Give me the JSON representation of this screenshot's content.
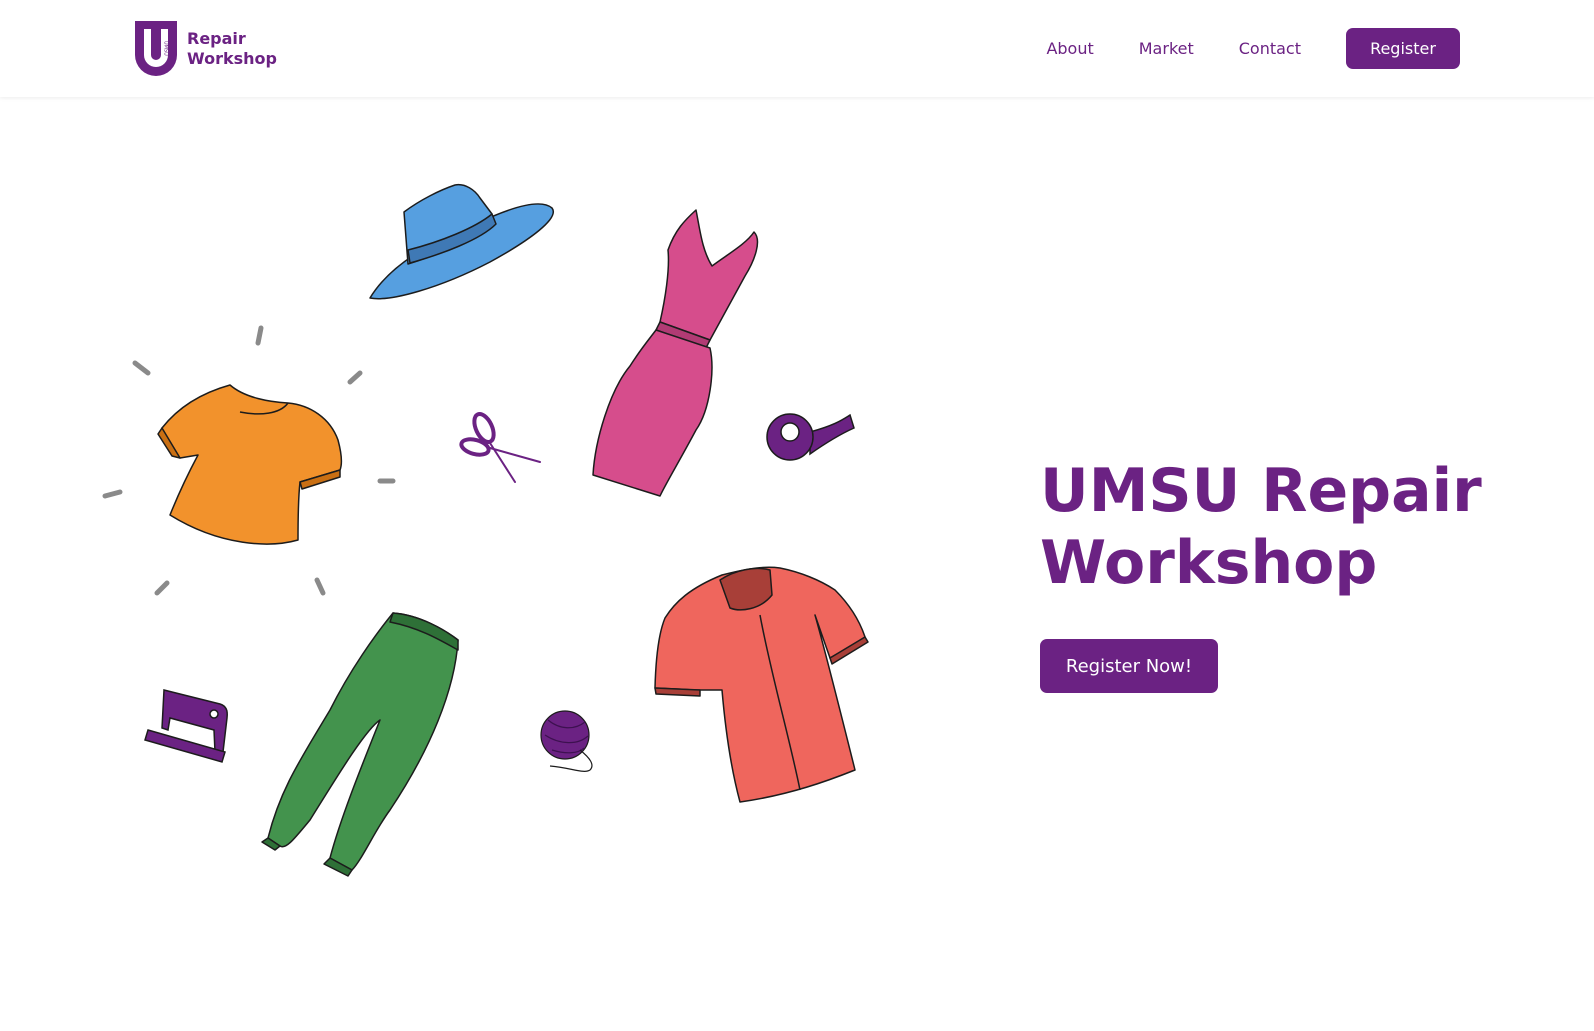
{
  "brand": {
    "logo_letter": "U",
    "logo_small": "UMSU",
    "line1": "Repair",
    "line2": "Workshop"
  },
  "nav": {
    "items": [
      {
        "label": "About"
      },
      {
        "label": "Market"
      },
      {
        "label": "Contact"
      }
    ],
    "register_label": "Register"
  },
  "hero": {
    "title_line1": "UMSU Repair",
    "title_line2": "Workshop",
    "cta_label": "Register Now!"
  },
  "colors": {
    "brand_purple": "#6b2283",
    "hat_blue": "#569fe0",
    "dress_pink": "#d64d8c",
    "tshirt_orange": "#f2922c",
    "pants_green": "#43934d",
    "shirt_coral": "#ef665d",
    "sparkle_gray": "#8a8a8a"
  },
  "illustration_icons": [
    "sun-hat-icon",
    "dress-icon",
    "tshirt-icon",
    "scissors-icon",
    "measuring-tape-icon",
    "pants-icon",
    "sewing-machine-icon",
    "yarn-ball-icon",
    "shirt-icon"
  ]
}
